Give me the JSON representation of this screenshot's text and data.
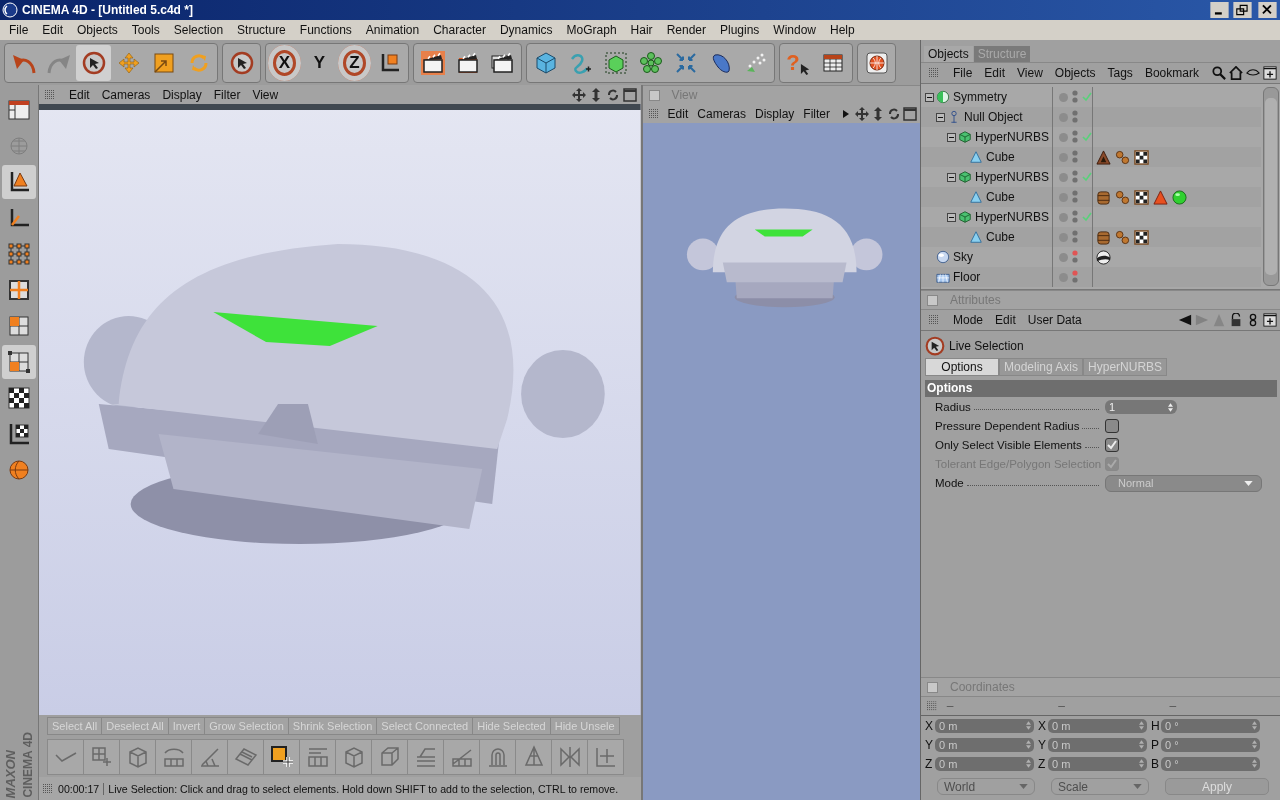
{
  "window": {
    "title": "CINEMA 4D - [Untitled 5.c4d *]"
  },
  "menu": [
    "File",
    "Edit",
    "Objects",
    "Tools",
    "Selection",
    "Structure",
    "Functions",
    "Animation",
    "Character",
    "Dynamics",
    "MoGraph",
    "Hair",
    "Render",
    "Plugins",
    "Window",
    "Help"
  ],
  "toolbar": [
    [
      {
        "kind": "undo"
      },
      {
        "kind": "redo",
        "disabled": true
      },
      {
        "kind": "live-selection",
        "selected": true
      },
      {
        "kind": "move",
        "selected": false
      },
      {
        "kind": "scale",
        "selected": false
      },
      {
        "kind": "rotate",
        "selected": false
      }
    ],
    [
      {
        "kind": "live-selection"
      }
    ],
    [
      {
        "kind": "axis",
        "label": "X",
        "on": true
      },
      {
        "kind": "axis",
        "label": "Y",
        "on": false
      },
      {
        "kind": "axis",
        "label": "Z",
        "on": true
      },
      {
        "kind": "coordinate-system"
      }
    ],
    [
      {
        "kind": "render-view"
      },
      {
        "kind": "render-picture-viewer"
      },
      {
        "kind": "render-settings"
      }
    ],
    [
      {
        "kind": "cube"
      },
      {
        "kind": "spline"
      },
      {
        "kind": "nurbs"
      },
      {
        "kind": "mograph"
      },
      {
        "kind": "deformer"
      },
      {
        "kind": "scene"
      },
      {
        "kind": "particles"
      }
    ],
    [
      {
        "kind": "help",
        "label": "?"
      },
      {
        "kind": "layout-table"
      }
    ],
    [
      {
        "kind": "browser"
      }
    ]
  ],
  "tool_column": [
    {
      "kind": "layout",
      "selected": false
    },
    {
      "kind": "sphere-grid",
      "selected": false
    },
    {
      "kind": "model",
      "selected": true
    },
    {
      "kind": "object-axis",
      "selected": false
    },
    {
      "kind": "points",
      "selected": false
    },
    {
      "kind": "edges",
      "selected": false
    },
    {
      "kind": "polygons",
      "selected": false
    },
    {
      "kind": "uv-polygons",
      "selected": true
    },
    {
      "kind": "texture",
      "selected": false
    },
    {
      "kind": "texture-axis",
      "selected": false
    },
    {
      "kind": "sculpt",
      "selected": false
    }
  ],
  "viewport": {
    "menu": [
      "Edit",
      "Cameras",
      "Display",
      "Filter",
      "View"
    ],
    "kind": "picture"
  },
  "view_panel": {
    "title": "View",
    "checked": false,
    "menu": [
      "Edit",
      "Cameras",
      "Display",
      "Filter"
    ],
    "kind": "picture"
  },
  "command_bar": {
    "disabled": true,
    "buttons": [
      "Select All",
      "Deselect All",
      "Invert",
      "Grow Selection",
      "Shrink Selection",
      "Select Connected",
      "Hide Selected",
      "Hide Unsele"
    ]
  },
  "command_icons": [
    {
      "kind": "line"
    },
    {
      "kind": "grid-plus"
    },
    {
      "kind": "box"
    },
    {
      "kind": "bridge"
    },
    {
      "kind": "knife"
    },
    {
      "kind": "plane"
    },
    {
      "kind": "square-plus"
    },
    {
      "kind": "bars"
    },
    {
      "kind": "box"
    },
    {
      "kind": "bevel"
    },
    {
      "kind": "extrude"
    },
    {
      "kind": "slope"
    },
    {
      "kind": "magnet"
    },
    {
      "kind": "pyramid"
    },
    {
      "kind": "mirror"
    },
    {
      "kind": "cross"
    }
  ],
  "logo": [
    "MAXON",
    "CINEMA 4D"
  ],
  "status_bar": {
    "time": "00:00:17",
    "message": "Live Selection: Click and drag to select elements. Hold down SHIFT to add to the selection, CTRL to remove."
  },
  "object_manager": {
    "tabs": [
      {
        "label": "Objects",
        "selected": true
      },
      {
        "label": "Structure",
        "selected": false
      }
    ],
    "menu": [
      "File",
      "Edit",
      "View",
      "Objects",
      "Tags",
      "Bookmark"
    ],
    "tree": [
      {
        "name": "Symmetry",
        "kind": "symmetry",
        "expanded": true,
        "enabled": true,
        "hidden_in_editor": false,
        "children": [
          {
            "name": "Null Object",
            "kind": "null",
            "expanded": true,
            "hidden_in_editor": false,
            "children": [
              {
                "name": "HyperNURBS",
                "kind": "hypernurbs",
                "expanded": true,
                "enabled": true,
                "hidden_in_editor": false,
                "children": [
                  {
                    "name": "Cube",
                    "kind": "polygon",
                    "hidden_in_editor": false,
                    "tags": [
                      {
                        "kind": "phong"
                      },
                      {
                        "kind": "uvw"
                      },
                      {
                        "kind": "texture"
                      }
                    ]
                  }
                ]
              },
              {
                "name": "HyperNURBS",
                "kind": "hypernurbs",
                "expanded": true,
                "enabled": true,
                "hidden_in_editor": false,
                "children": [
                  {
                    "name": "Cube",
                    "kind": "polygon",
                    "hidden_in_editor": false,
                    "tags": [
                      {
                        "kind": "material"
                      },
                      {
                        "kind": "uvw"
                      },
                      {
                        "kind": "texture"
                      },
                      {
                        "kind": "selection"
                      },
                      {
                        "kind": "glow-material"
                      }
                    ]
                  }
                ]
              },
              {
                "name": "HyperNURBS",
                "kind": "hypernurbs",
                "expanded": true,
                "enabled": true,
                "hidden_in_editor": false,
                "children": [
                  {
                    "name": "Cube",
                    "kind": "polygon",
                    "hidden_in_editor": false,
                    "tags": [
                      {
                        "kind": "material"
                      },
                      {
                        "kind": "uvw"
                      },
                      {
                        "kind": "texture"
                      }
                    ]
                  }
                ]
              }
            ]
          }
        ]
      },
      {
        "name": "Sky",
        "kind": "sky",
        "hidden_in_editor": true,
        "tags": [
          {
            "kind": "sky-material"
          }
        ]
      },
      {
        "name": "Floor",
        "kind": "floor",
        "hidden_in_editor": true
      }
    ]
  },
  "attributes": {
    "title": "Attributes",
    "checked": false,
    "menu": [
      "Mode",
      "Edit",
      "User Data"
    ],
    "tool": "Live Selection",
    "tabs": [
      {
        "label": "Options",
        "selected": true
      },
      {
        "label": "Modeling Axis",
        "selected": false
      },
      {
        "label": "HyperNURBS",
        "selected": false
      }
    ],
    "section": "Options",
    "fields": [
      {
        "kind": "number",
        "label": "Radius",
        "value": "1",
        "disabled": false
      },
      {
        "kind": "checkbox",
        "label": "Pressure Dependent Radius",
        "checked": false,
        "disabled": false
      },
      {
        "kind": "checkbox",
        "label": "Only Select Visible Elements",
        "checked": true,
        "disabled": false
      },
      {
        "kind": "checkbox",
        "label": "Tolerant Edge/Polygon Selection",
        "checked": true,
        "disabled": true
      },
      {
        "kind": "select",
        "label": "Mode",
        "value": "Normal",
        "disabled": false
      }
    ]
  },
  "coordinates": {
    "title": "Coordinates",
    "checked": false,
    "disabled": true,
    "headers": [
      "–",
      "–",
      "–"
    ],
    "rows": [
      [
        {
          "axis": "X",
          "value": "0 m"
        },
        {
          "axis": "X",
          "value": "0 m"
        },
        {
          "axis": "H",
          "value": "0 °"
        }
      ],
      [
        {
          "axis": "Y",
          "value": "0 m"
        },
        {
          "axis": "Y",
          "value": "0 m"
        },
        {
          "axis": "P",
          "value": "0 °"
        }
      ],
      [
        {
          "axis": "Z",
          "value": "0 m"
        },
        {
          "axis": "Z",
          "value": "0 m"
        },
        {
          "axis": "B",
          "value": "0 °"
        }
      ]
    ],
    "selects": [
      "World",
      "Scale"
    ],
    "apply": "Apply"
  }
}
